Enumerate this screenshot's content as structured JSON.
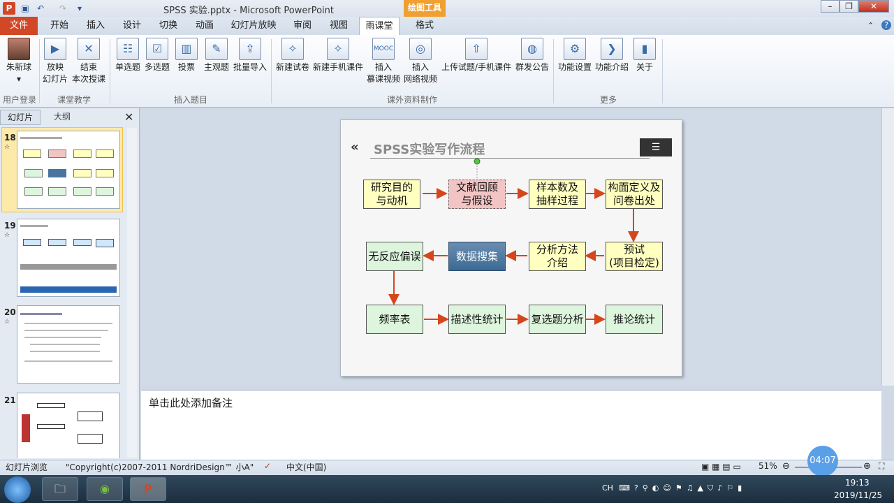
{
  "window": {
    "title": "SPSS 实验.pptx - Microsoft PowerPoint",
    "context_tab": "绘图工具",
    "app_icon": "P"
  },
  "tabs": [
    "文件",
    "开始",
    "插入",
    "设计",
    "切换",
    "动画",
    "幻灯片放映",
    "审阅",
    "视图",
    "雨课堂",
    "格式"
  ],
  "ribbon": {
    "user": {
      "name": "朱新球",
      "group": "用户登录"
    },
    "class": {
      "items": [
        "放映\n幻灯片",
        "结束\n本次授课"
      ],
      "group": "课堂教学"
    },
    "insert_q": {
      "items": [
        "单选题",
        "多选题",
        "投票",
        "主观题",
        "批量导入"
      ],
      "group": "插入题目"
    },
    "extra": {
      "items": [
        "新建试卷",
        "新建手机课件",
        "插入\n慕课视频",
        "插入\n网络视频",
        "上传试题/手机课件",
        "群发公告"
      ],
      "group": "课外资料制作"
    },
    "more": {
      "items": [
        "功能设置",
        "功能介绍",
        "关于"
      ],
      "group": "更多"
    }
  },
  "panel": {
    "tab_slides": "幻灯片",
    "tab_outline": "大纲",
    "close": "✕"
  },
  "thumbs": [
    {
      "num": "18"
    },
    {
      "num": "19"
    },
    {
      "num": "20"
    },
    {
      "num": "21"
    }
  ],
  "slide": {
    "title": "SPSS实验写作流程",
    "boxes": {
      "b1": "研究目的\n与动机",
      "b2": "文献回顾\n与假设",
      "b3": "样本数及\n抽样过程",
      "b4": "构面定义及\n问卷出处",
      "b5": "无反应偏误",
      "b6": "数据搜集",
      "b7": "分析方法\n介绍",
      "b8": "预试\n(项目检定)",
      "b9": "频率表",
      "b10": "描述性统计",
      "b11": "复选题分析",
      "b12": "推论统计"
    }
  },
  "notes_placeholder": "单击此处添加备注",
  "status": {
    "view": "幻灯片浏览",
    "theme": "\"Copyright(c)2007-2011 NordriDesign™ 小A\"",
    "lang": "中文(中国)",
    "zoom": "51%",
    "timer": "04:07"
  },
  "clock": {
    "time": "19:13",
    "date": "2019/11/25"
  },
  "tray": {
    "ime": "CH"
  }
}
